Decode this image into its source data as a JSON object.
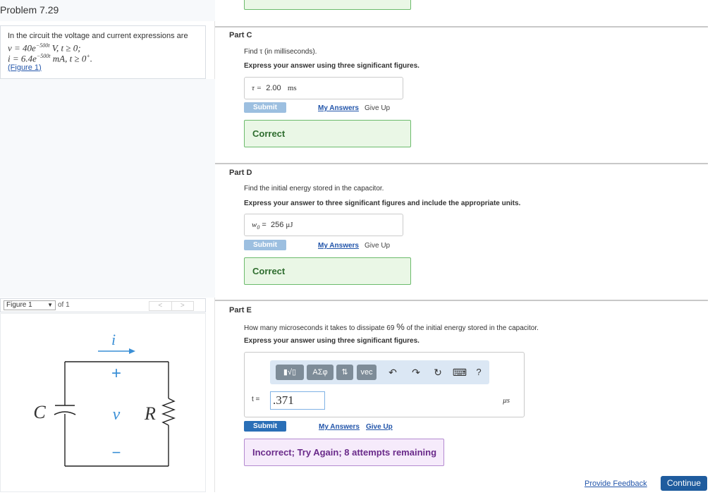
{
  "problem": {
    "title": "Problem 7.29",
    "intro": "In the circuit the voltage and current expressions are",
    "eq_v": "v = 40e",
    "eq_v_exp": "−500t",
    "eq_v_tail": " V, t ≥ 0;",
    "eq_i": "i = 6.4e",
    "eq_i_exp": "−500t",
    "eq_i_tail": " mA, t ≥ 0",
    "eq_i_sup": "+",
    "eq_i_end": ".",
    "figure_link": "(Figure 1)"
  },
  "figure": {
    "select_label": "Figure 1",
    "of_label": "of 1",
    "prev": "<",
    "next": ">",
    "labels": {
      "i": "i",
      "plus": "+",
      "v": "v",
      "minus": "−",
      "C": "C",
      "R": "R"
    }
  },
  "partC": {
    "label": "Part C",
    "question": "Find τ (in milliseconds).",
    "instruction": "Express your answer using three significant figures.",
    "var": "τ =",
    "value": "2.00",
    "unit": "ms",
    "submit": "Submit",
    "my_answers": "My Answers",
    "give_up": "Give Up",
    "feedback": "Correct"
  },
  "partD": {
    "label": "Part D",
    "question": "Find the initial energy stored in the capacitor.",
    "instruction": "Express your answer to three significant figures and include the appropriate units.",
    "var": "w",
    "var_sub": "0",
    "eq": "=",
    "value": "256",
    "unit": "μJ",
    "submit": "Submit",
    "my_answers": "My Answers",
    "give_up": "Give Up",
    "feedback": "Correct"
  },
  "partE": {
    "label": "Part E",
    "question_pre": "How many microseconds it takes to dissipate 69",
    "question_pct": "%",
    "question_post": "of the initial energy stored in the capacitor.",
    "instruction": "Express your answer using three significant figures.",
    "toolbar": {
      "templates": "▮√▯",
      "greek": "ΑΣφ",
      "arrows": "⇅",
      "vec": "vec",
      "undo": "↶",
      "redo": "↷",
      "reset": "↻",
      "keyboard": "⌨",
      "help": "?"
    },
    "var": "t =",
    "input_value": ".371",
    "unit": "μs",
    "submit": "Submit",
    "my_answers": "My Answers",
    "give_up": "Give Up",
    "feedback": "Incorrect; Try Again; 8 attempts remaining"
  },
  "footer": {
    "provide_feedback": "Provide Feedback",
    "continue": "Continue"
  },
  "colors": {
    "correct_border": "#6cbb6c",
    "incorrect_border": "#b48ad0",
    "submit_active": "#2a6fb7",
    "submit_disabled": "#9cbfe0",
    "continue": "#1f5c9e"
  }
}
